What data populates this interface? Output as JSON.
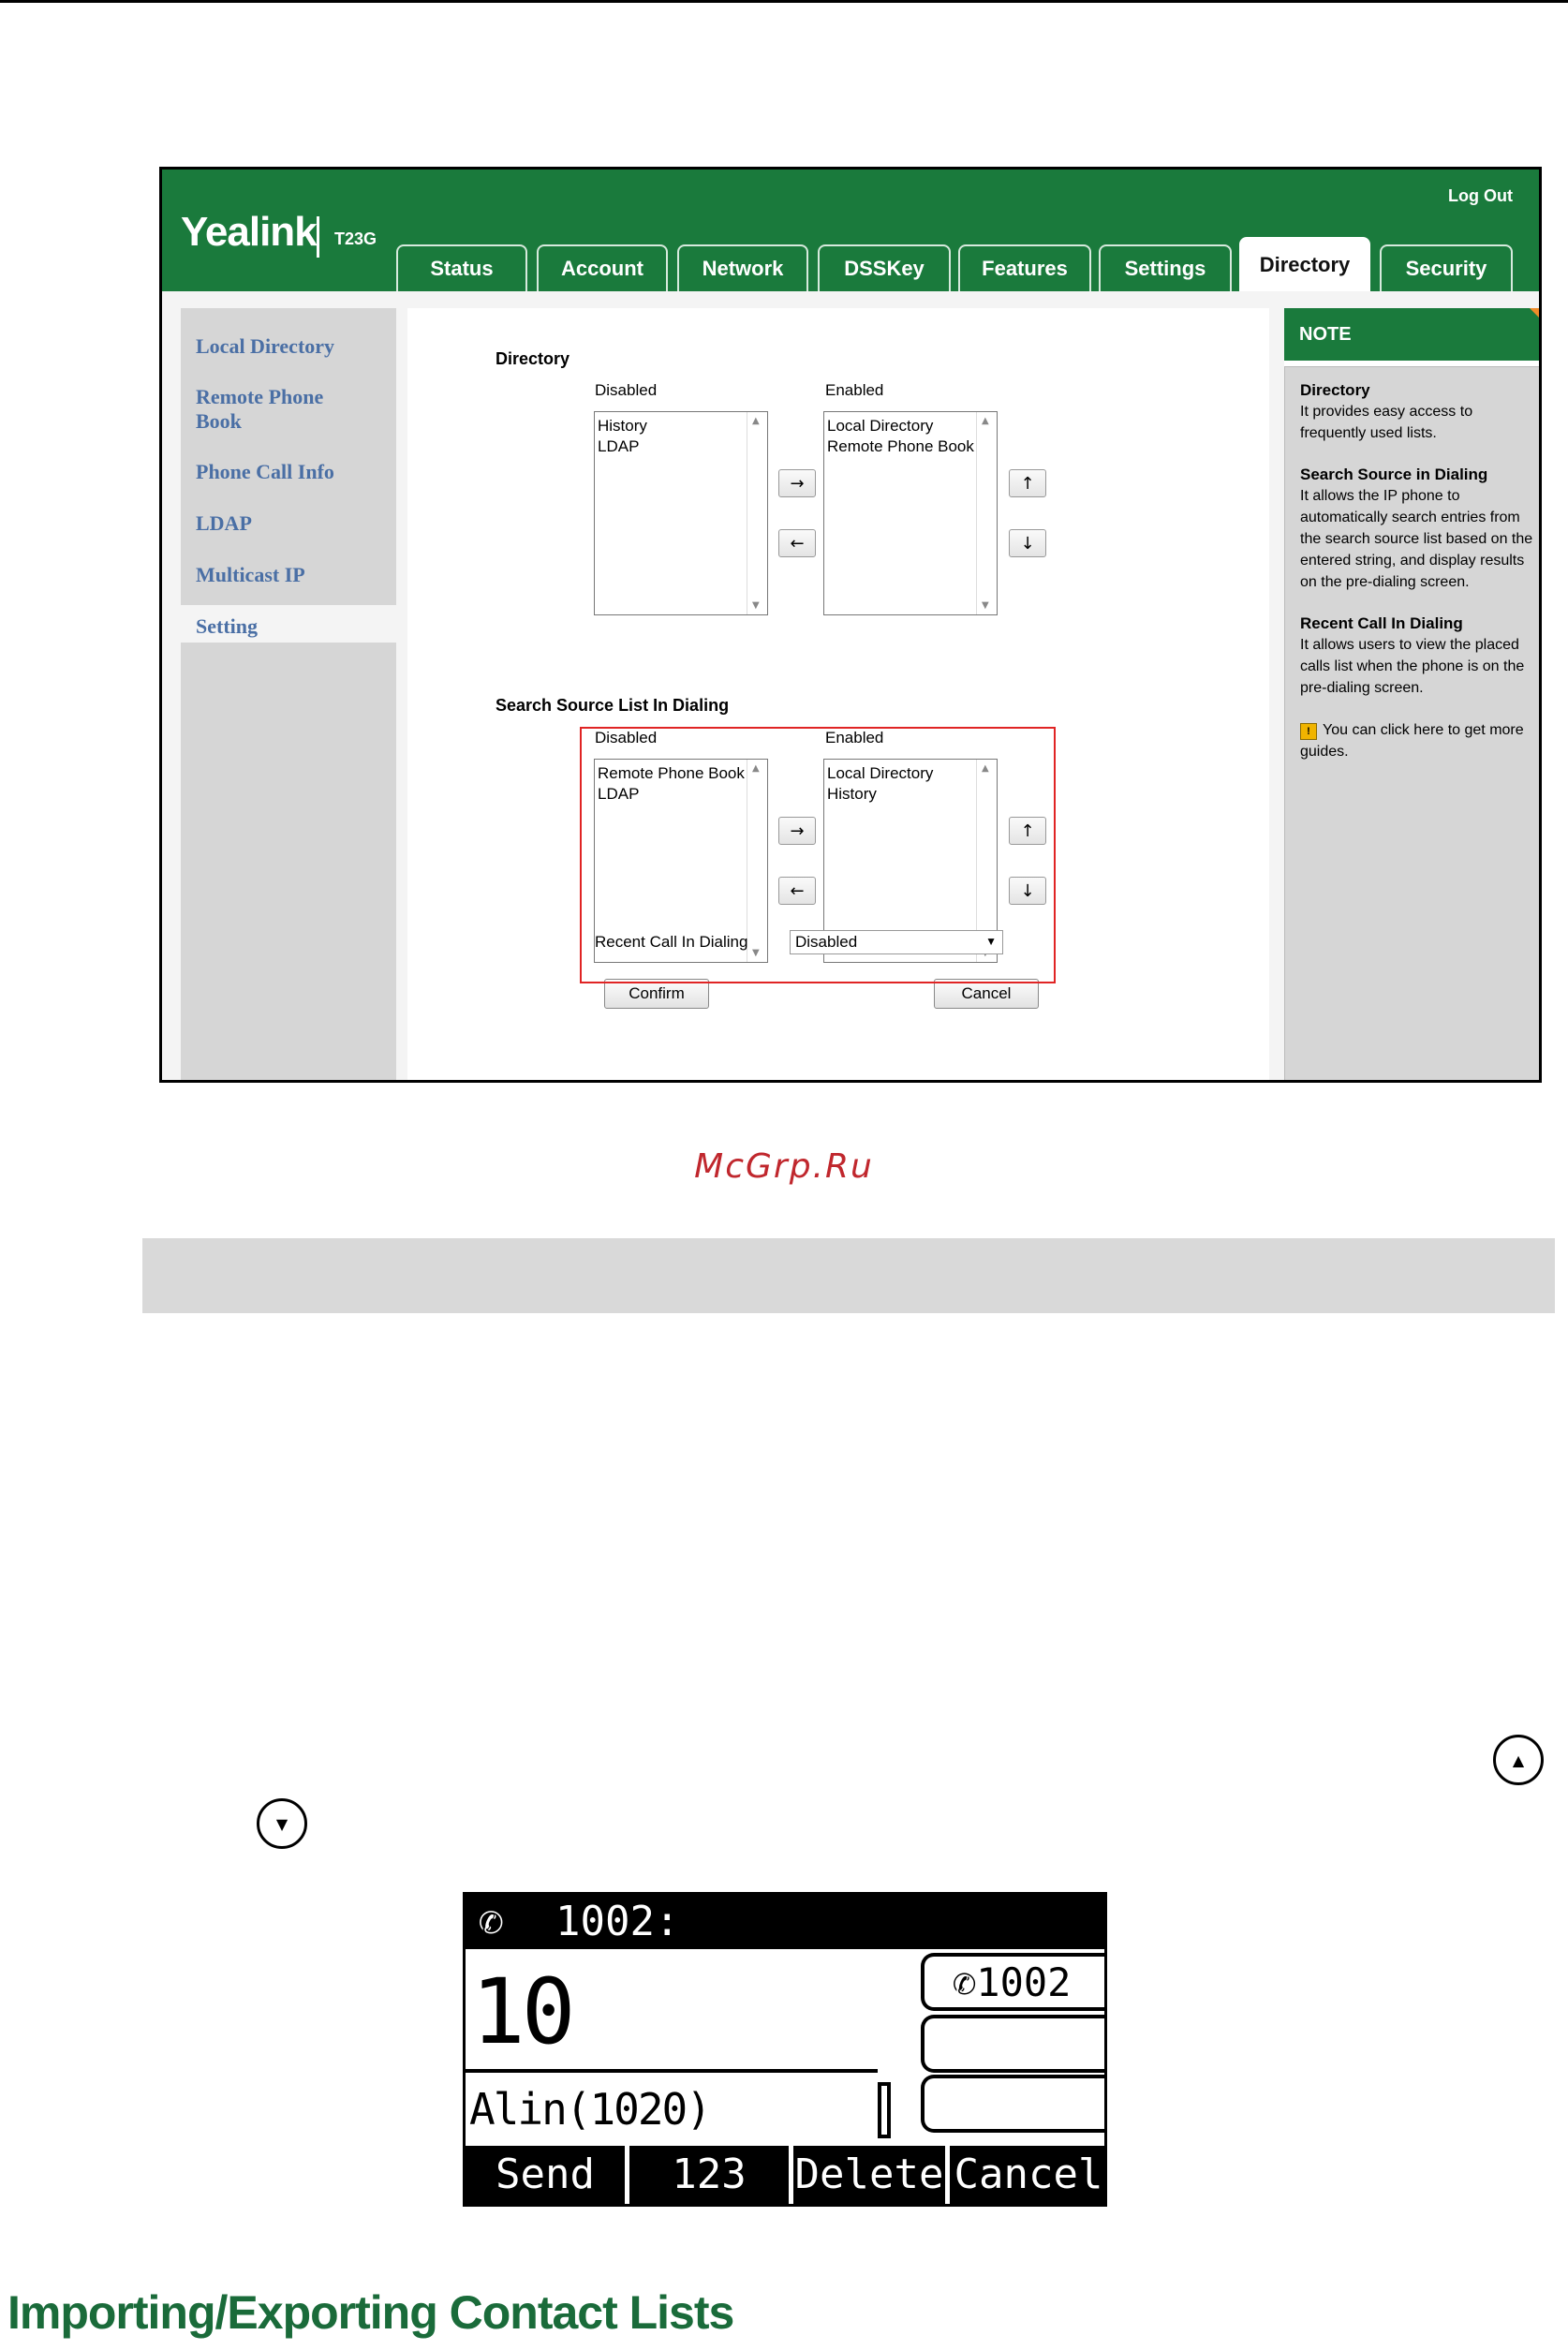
{
  "app": {
    "logo": "Yealink",
    "model": "T23G",
    "logout": "Log Out"
  },
  "tabs": [
    "Status",
    "Account",
    "Network",
    "DSSKey",
    "Features",
    "Settings",
    "Directory",
    "Security"
  ],
  "sidebar": [
    "Local Directory",
    "Remote Phone Book",
    "Phone Call Info",
    "LDAP",
    "Multicast IP",
    "Setting"
  ],
  "directory": {
    "title": "Directory",
    "disabled_label": "Disabled",
    "enabled_label": "Enabled",
    "disabled_items": [
      "History",
      "LDAP"
    ],
    "enabled_items": [
      "Local Directory",
      "Remote Phone Book"
    ]
  },
  "search_source": {
    "title": "Search Source List In Dialing",
    "disabled_label": "Disabled",
    "enabled_label": "Enabled",
    "disabled_items": [
      "Remote Phone Book",
      "LDAP"
    ],
    "enabled_items": [
      "Local Directory",
      "History"
    ]
  },
  "arrows": {
    "right": "→",
    "left": "←",
    "up": "↑",
    "down": "↓"
  },
  "recent_call": {
    "label": "Recent Call In Dialing",
    "value": "Disabled"
  },
  "buttons": {
    "confirm": "Confirm",
    "cancel": "Cancel"
  },
  "note": {
    "header": "NOTE",
    "s1_title": "Directory",
    "s1_body": "It provides easy access to frequently used lists.",
    "s2_title": "Search Source in Dialing",
    "s2_body": "It allows the IP phone to automatically search entries from the search source list based on the entered string, and display results on the pre-dialing screen.",
    "s3_title": "Recent Call In Dialing",
    "s3_body": "It allows users to view the placed calls list when the phone is on the pre-dialing screen.",
    "guide": "You can click here to get more guides."
  },
  "watermark": "McGrp.Ru",
  "phone": {
    "top": "1002:",
    "input": "10",
    "suggestion": "Alin(1020)",
    "line_label": "1002",
    "softkeys": [
      "Send",
      "123",
      "Delete",
      "Cancel"
    ]
  },
  "heading": "Importing/Exporting Contact Lists"
}
